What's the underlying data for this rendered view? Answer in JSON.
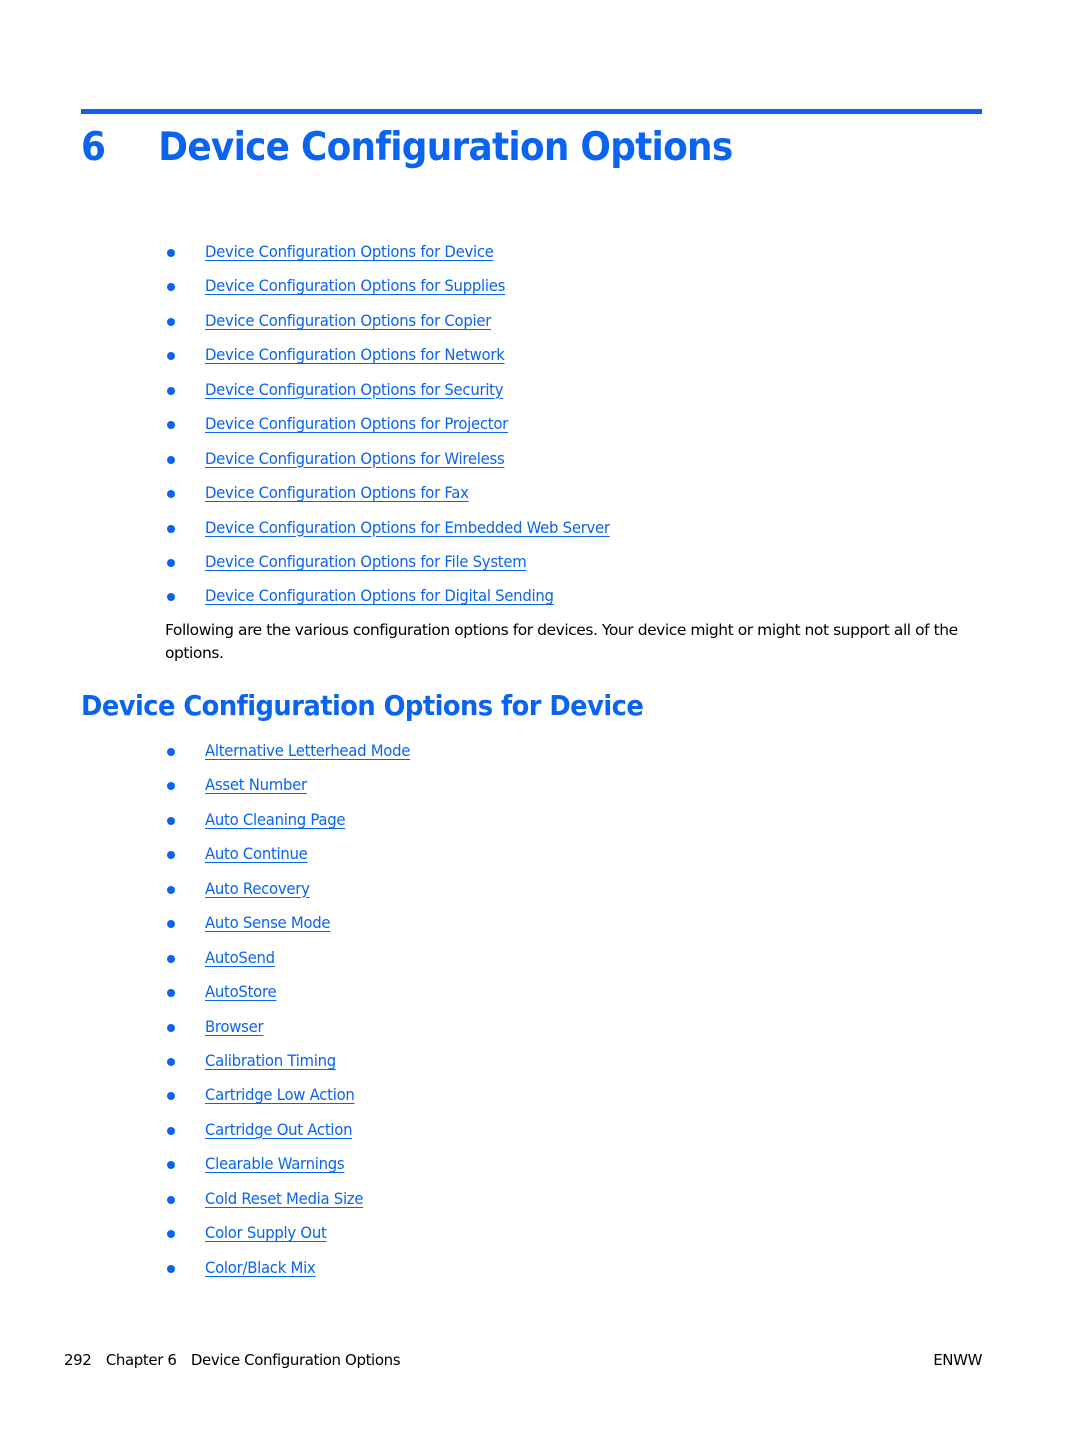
{
  "colors": {
    "accent": "#0a64f0",
    "text": "#000000"
  },
  "chapter": {
    "number": "6",
    "title": "Device Configuration Options"
  },
  "chapter_toc": [
    "Device Configuration Options for Device",
    "Device Configuration Options for Supplies",
    "Device Configuration Options for Copier",
    "Device Configuration Options for Network",
    "Device Configuration Options for Security",
    "Device Configuration Options for Projector",
    "Device Configuration Options for Wireless",
    "Device Configuration Options for Fax",
    "Device Configuration Options for Embedded Web Server",
    "Device Configuration Options for File System",
    "Device Configuration Options for Digital Sending"
  ],
  "intro_text": "Following are the various configuration options for devices. Your device might or might not support all of the options.",
  "section": {
    "title": "Device Configuration Options for Device",
    "items": [
      "Alternative Letterhead Mode",
      "Asset Number",
      "Auto Cleaning Page",
      "Auto Continue",
      "Auto Recovery",
      "Auto Sense Mode",
      "AutoSend",
      "AutoStore",
      "Browser",
      "Calibration Timing",
      "Cartridge Low Action",
      "Cartridge Out Action",
      "Clearable Warnings",
      "Cold Reset Media Size",
      "Color Supply Out",
      "Color/Black Mix"
    ]
  },
  "footer": {
    "page_number": "292",
    "chapter_label": "Chapter 6",
    "chapter_title": "Device Configuration Options",
    "locale_code": "ENWW"
  }
}
